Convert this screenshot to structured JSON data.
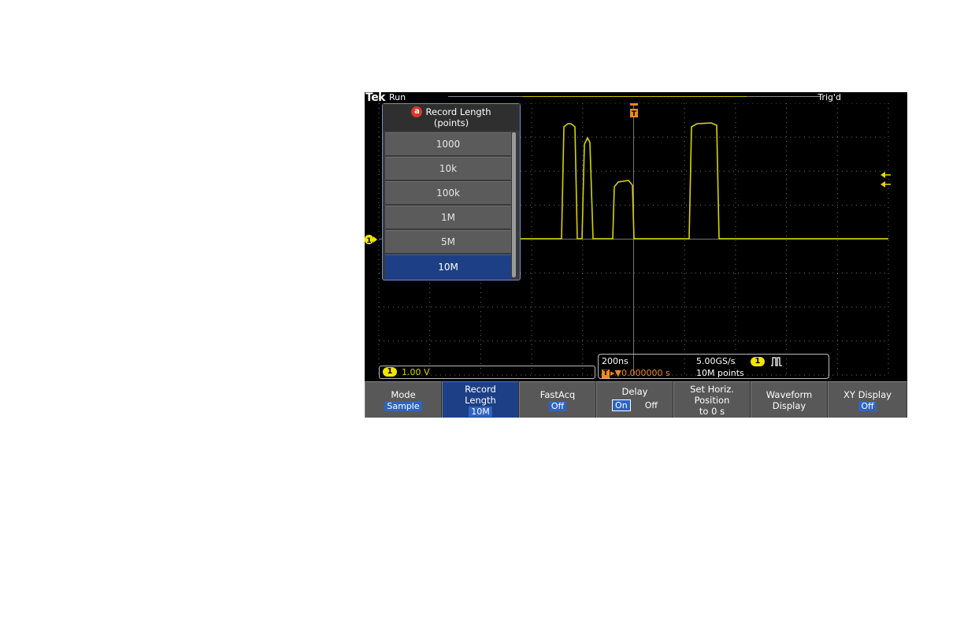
{
  "status": {
    "brand": "Tek",
    "acq_state": "Run",
    "trigger_state": "Trig'd"
  },
  "record_length_menu": {
    "badge": "a",
    "title": "Record Length",
    "subtitle": "(points)",
    "options": [
      "1000",
      "10k",
      "100k",
      "1M",
      "5M",
      "10M"
    ],
    "selected": "10M"
  },
  "channel": {
    "number": "1",
    "scale": "1.00 V",
    "color": "#f0e600"
  },
  "horizontal": {
    "time_per_div": "200ns",
    "trigger_position": "0.000000 s",
    "trigger_label": "T",
    "sample_rate": "5.00GS/s",
    "record_points": "10M points",
    "trigger_channel": "1"
  },
  "trigger_marker": "T",
  "softkeys": {
    "mode": {
      "label": "Mode",
      "value": "Sample"
    },
    "record_length": {
      "label_line1": "Record",
      "label_line2": "Length",
      "value": "10M"
    },
    "fastacq": {
      "label": "FastAcq",
      "value": "Off"
    },
    "delay": {
      "label": "Delay",
      "on": "On",
      "off": "Off"
    },
    "set_horiz": {
      "line1": "Set Horiz.",
      "line2": "Position",
      "line3": "to 0 s"
    },
    "waveform_display": {
      "line1": "Waveform",
      "line2": "Display"
    },
    "xy_display": {
      "label": "XY Display",
      "value": "Off"
    }
  },
  "colors": {
    "trace": "#d8d400",
    "menu_selected": "#1d3f86",
    "trigger_orange": "#f08a1c"
  }
}
